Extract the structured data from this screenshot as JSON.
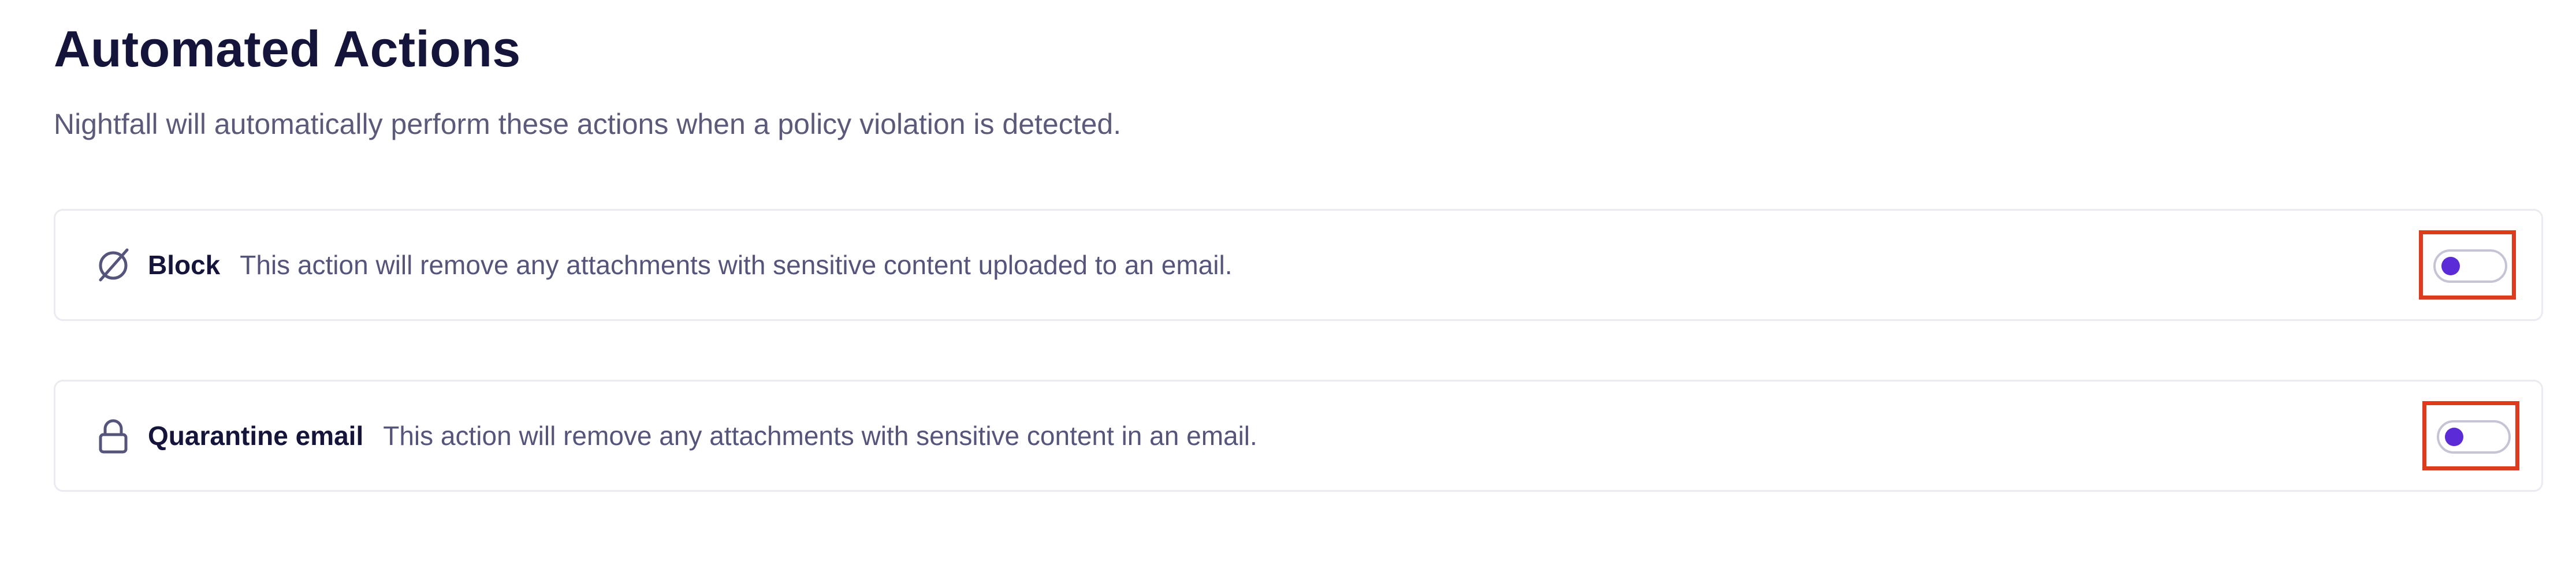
{
  "page": {
    "title": "Automated Actions",
    "subtitle": "Nightfall will automatically perform these actions when a policy violation is detected."
  },
  "actions": [
    {
      "name": "Block",
      "description": "This action will remove any attachments with sensitive content uploaded to an email.",
      "icon": "block-icon",
      "enabled": false
    },
    {
      "name": "Quarantine email",
      "description": "This action will remove any attachments with sensitive content in an email.",
      "icon": "lock-icon",
      "enabled": false
    }
  ],
  "colors": {
    "accent": "#5a2bd6",
    "highlight": "#e03a1e",
    "title_text": "#15143a",
    "muted_text": "#5b5a7a",
    "card_border": "#ebeaf0"
  }
}
